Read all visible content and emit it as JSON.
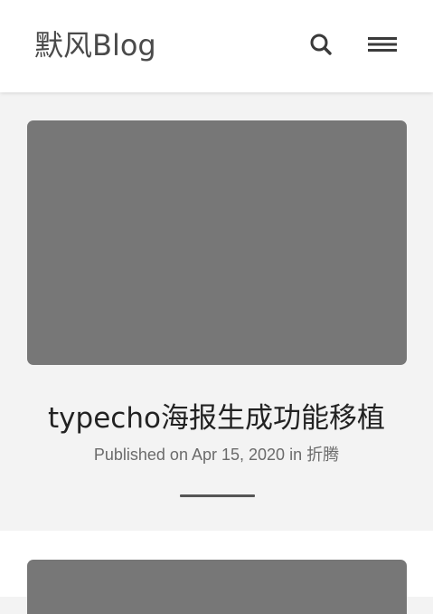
{
  "header": {
    "brand": "默风Blog",
    "search_icon": "search-icon",
    "menu_icon": "hamburger-menu-icon"
  },
  "posts": [
    {
      "title": "typecho海报生成功能移植",
      "meta_prefix": "Published on",
      "date": "Apr 15, 2020",
      "meta_in": "in",
      "category": "折腾",
      "thumb_color": "#777777"
    }
  ],
  "colors": {
    "page_background": "#f3f3f3",
    "header_background": "#ffffff",
    "thumbnail_placeholder": "#777777",
    "divider": "#555555"
  }
}
